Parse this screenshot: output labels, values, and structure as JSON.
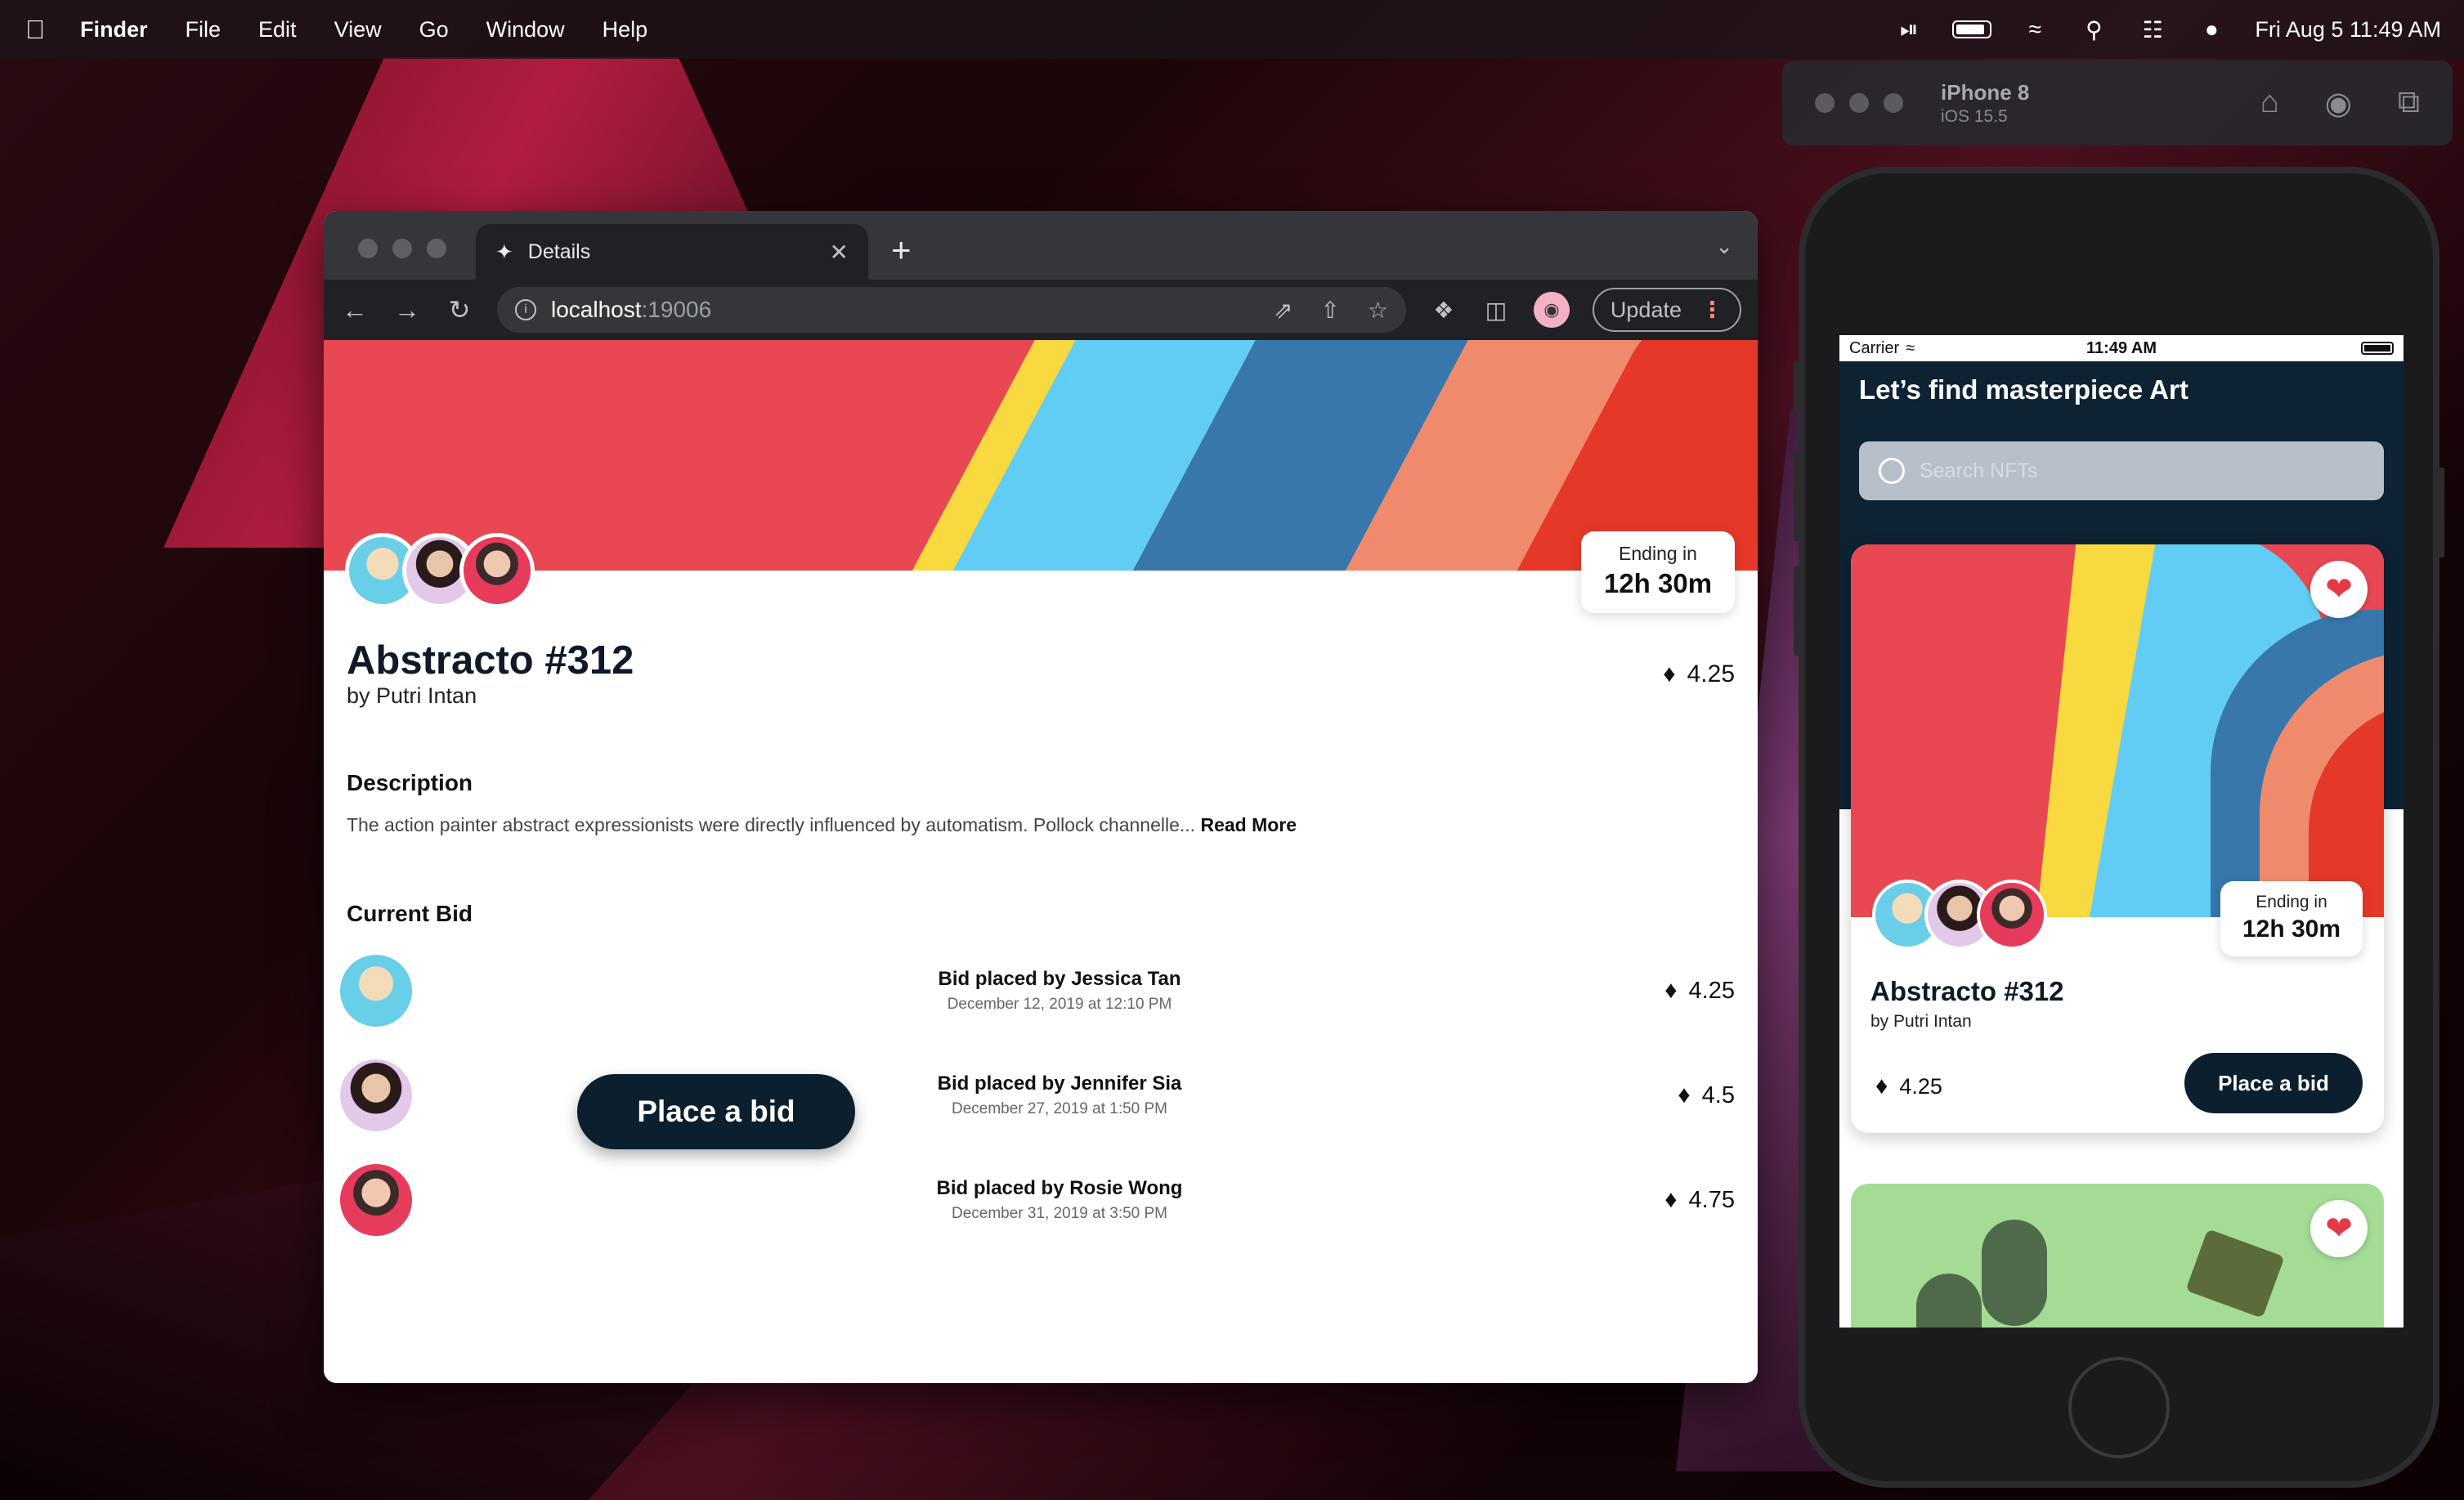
{
  "menubar": {
    "app": "Finder",
    "items": [
      "File",
      "Edit",
      "View",
      "Go",
      "Window",
      "Help"
    ],
    "datetime": "Fri Aug 5  11:49 AM"
  },
  "browser": {
    "tab_title": "Details",
    "url_host": "localhost",
    "url_port": ":19006",
    "update_label": "Update"
  },
  "detail": {
    "ending_label": "Ending in",
    "ending_value": "12h 30m",
    "title": "Abstracto #312",
    "author": "by Putri Intan",
    "price": "4.25",
    "description_heading": "Description",
    "description": "The action painter abstract expressionists were directly influenced by automatism. Pollock channelle...",
    "read_more": "Read More",
    "current_bid_heading": "Current Bid",
    "bids": [
      {
        "who": "Bid placed by Jessica Tan",
        "when": "December 12, 2019 at 12:10 PM",
        "amount": "4.25"
      },
      {
        "who": "Bid placed by Jennifer Sia",
        "when": "December 27, 2019 at 1:50 PM",
        "amount": "4.5"
      },
      {
        "who": "Bid placed by Rosie Wong",
        "when": "December 31, 2019 at 3:50 PM",
        "amount": "4.75"
      }
    ],
    "place_bid": "Place a bid"
  },
  "simulator": {
    "device": "iPhone 8",
    "os": "iOS 15.5",
    "carrier": "Carrier",
    "time": "11:49 AM",
    "app_title": "Let’s find masterpiece Art",
    "search_placeholder": "Search NFTs",
    "card": {
      "ending_label": "Ending in",
      "ending_value": "12h 30m",
      "title": "Abstracto #312",
      "author": "by Putri Intan",
      "price": "4.25",
      "button": "Place a bid"
    }
  },
  "icons": {
    "apple": "apple-icon",
    "eth": "ethereum-icon",
    "heart": "heart-icon"
  },
  "colors": {
    "primary": "#0b1f2f",
    "banner_red": "#e94852",
    "heart": "#e63946"
  }
}
